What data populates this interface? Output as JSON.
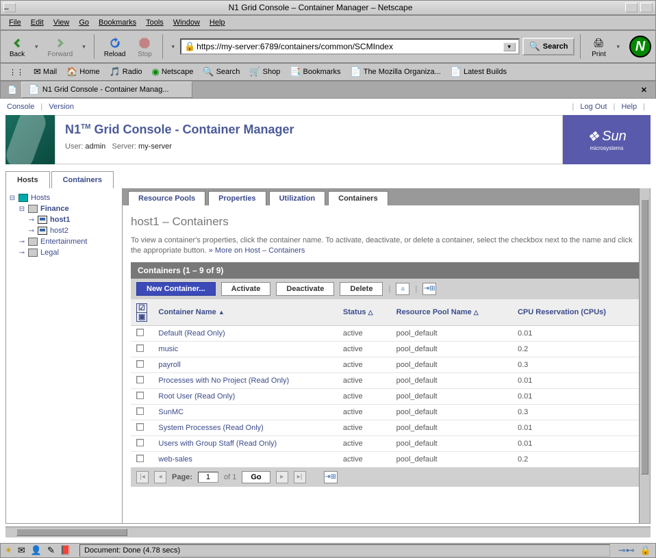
{
  "window": {
    "title": "N1 Grid Console – Container Manager – Netscape"
  },
  "menubar": [
    "File",
    "Edit",
    "View",
    "Go",
    "Bookmarks",
    "Tools",
    "Window",
    "Help"
  ],
  "toolbar1": {
    "back": "Back",
    "forward": "Forward",
    "reload": "Reload",
    "stop": "Stop",
    "url": "https://my-server:6789/containers/common/SCMIndex",
    "search": "Search",
    "print": "Print"
  },
  "toolbar2": [
    "Mail",
    "Home",
    "Radio",
    "Netscape",
    "Search",
    "Shop",
    "Bookmarks",
    "The Mozilla Organiza...",
    "Latest Builds"
  ],
  "browser_tab": "N1 Grid Console - Container Manag...",
  "app_topbar": {
    "console": "Console",
    "version": "Version",
    "logout": "Log Out",
    "help": "Help"
  },
  "app_header": {
    "title_pre": "N1",
    "title_sup": "TM",
    "title_main": " Grid Console - Container Manager",
    "user_label": "User:",
    "user": "admin",
    "server_label": "Server:",
    "server": "my-server",
    "sun": "Sun",
    "micro": "microsystems"
  },
  "main_tabs": {
    "hosts": "Hosts",
    "containers": "Containers"
  },
  "tree": {
    "root": "Hosts",
    "items": [
      {
        "label": "Finance"
      },
      {
        "label": "host1"
      },
      {
        "label": "host2"
      },
      {
        "label": "Entertainment"
      },
      {
        "label": "Legal"
      }
    ]
  },
  "sub_tabs": [
    "Resource Pools",
    "Properties",
    "Utilization",
    "Containers"
  ],
  "detail": {
    "heading": "host1 – Containers",
    "desc1": "To view a container's properties, click the container name. To activate, deactivate, or delete a container, select the checkbox next to the name and click the appropriate button. ",
    "more": "» More on Host – Containers",
    "table_title": "Containers (1 – 9 of 9)",
    "actions": {
      "new": "New Container...",
      "activate": "Activate",
      "deactivate": "Deactivate",
      "delete": "Delete"
    },
    "columns": {
      "name": "Container Name",
      "status": "Status",
      "pool": "Resource Pool Name",
      "cpu": "CPU Reservation (CPUs)"
    },
    "rows": [
      {
        "name": "Default (Read Only)",
        "status": "active",
        "pool": "pool_default",
        "cpu": "0.01"
      },
      {
        "name": "music",
        "status": "active",
        "pool": "pool_default",
        "cpu": "0.2"
      },
      {
        "name": "payroll",
        "status": "active",
        "pool": "pool_default",
        "cpu": "0.3"
      },
      {
        "name": "Processes with No Project (Read Only)",
        "status": "active",
        "pool": "pool_default",
        "cpu": "0.01"
      },
      {
        "name": "Root User (Read Only)",
        "status": "active",
        "pool": "pool_default",
        "cpu": "0.01"
      },
      {
        "name": "SunMC",
        "status": "active",
        "pool": "pool_default",
        "cpu": "0.3"
      },
      {
        "name": "System Processes (Read Only)",
        "status": "active",
        "pool": "pool_default",
        "cpu": "0.01"
      },
      {
        "name": "Users with Group Staff (Read Only)",
        "status": "active",
        "pool": "pool_default",
        "cpu": "0.01"
      },
      {
        "name": "web-sales",
        "status": "active",
        "pool": "pool_default",
        "cpu": "0.2"
      }
    ],
    "pagination": {
      "page_label": "Page:",
      "page": "1",
      "of": "of 1",
      "go": "Go"
    }
  },
  "statusbar": {
    "text": "Document: Done (4.78 secs)"
  }
}
